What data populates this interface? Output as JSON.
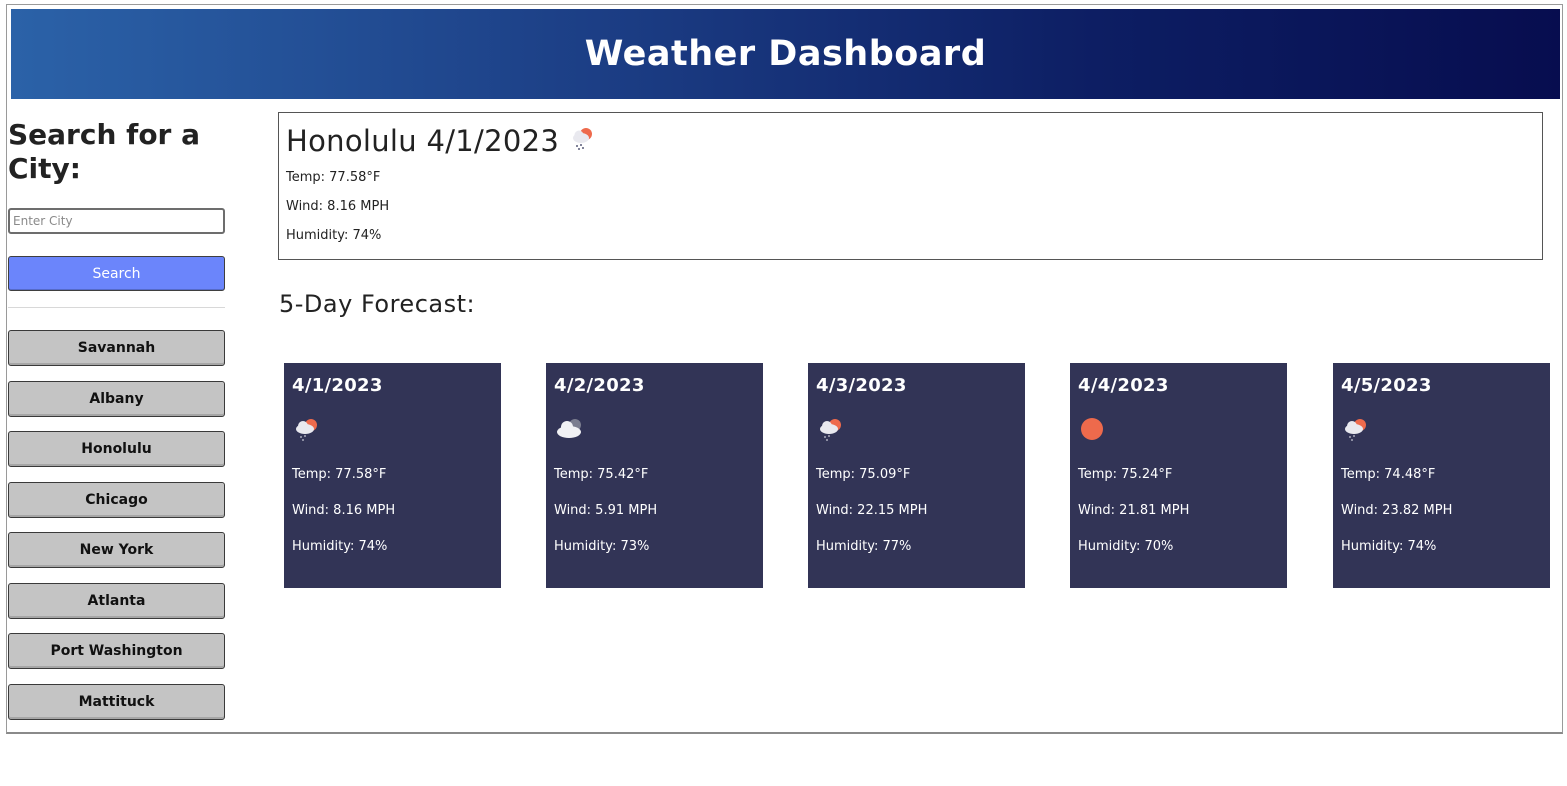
{
  "header": {
    "title": "Weather Dashboard"
  },
  "sidebar": {
    "heading": "Search for a City:",
    "search_placeholder": "Enter City",
    "search_value": "",
    "search_button_label": "Search",
    "history": [
      "Savannah",
      "Albany",
      "Honolulu",
      "Chicago",
      "New York",
      "Atlanta",
      "Port Washington",
      "Mattituck"
    ]
  },
  "current": {
    "title": "Honolulu 4/1/2023",
    "icon": "rain-cloud-sun-icon",
    "temp": "Temp: 77.58°F",
    "wind": "Wind: 8.16 MPH",
    "humidity": "Humidity: 74%"
  },
  "forecast": {
    "heading": "5-Day Forecast:",
    "days": [
      {
        "date": "4/1/2023",
        "icon": "cloud-sun-rain-icon",
        "temp": "Temp: 77.58°F",
        "wind": "Wind: 8.16 MPH",
        "humidity": "Humidity: 74%"
      },
      {
        "date": "4/2/2023",
        "icon": "cloud-icon",
        "temp": "Temp: 75.42°F",
        "wind": "Wind: 5.91 MPH",
        "humidity": "Humidity: 73%"
      },
      {
        "date": "4/3/2023",
        "icon": "cloud-sun-rain-icon",
        "temp": "Temp: 75.09°F",
        "wind": "Wind: 22.15 MPH",
        "humidity": "Humidity: 77%"
      },
      {
        "date": "4/4/2023",
        "icon": "sun-icon",
        "temp": "Temp: 75.24°F",
        "wind": "Wind: 21.81 MPH",
        "humidity": "Humidity: 70%"
      },
      {
        "date": "4/5/2023",
        "icon": "cloud-sun-rain-icon",
        "temp": "Temp: 74.48°F",
        "wind": "Wind: 23.82 MPH",
        "humidity": "Humidity: 74%"
      }
    ]
  },
  "colors": {
    "header_start": "#2b62a8",
    "header_end": "#070d4f",
    "search_button": "#6b85fb",
    "history_button": "#c4c4c4",
    "card_background": "#323456",
    "sun": "#ee6a4c"
  }
}
